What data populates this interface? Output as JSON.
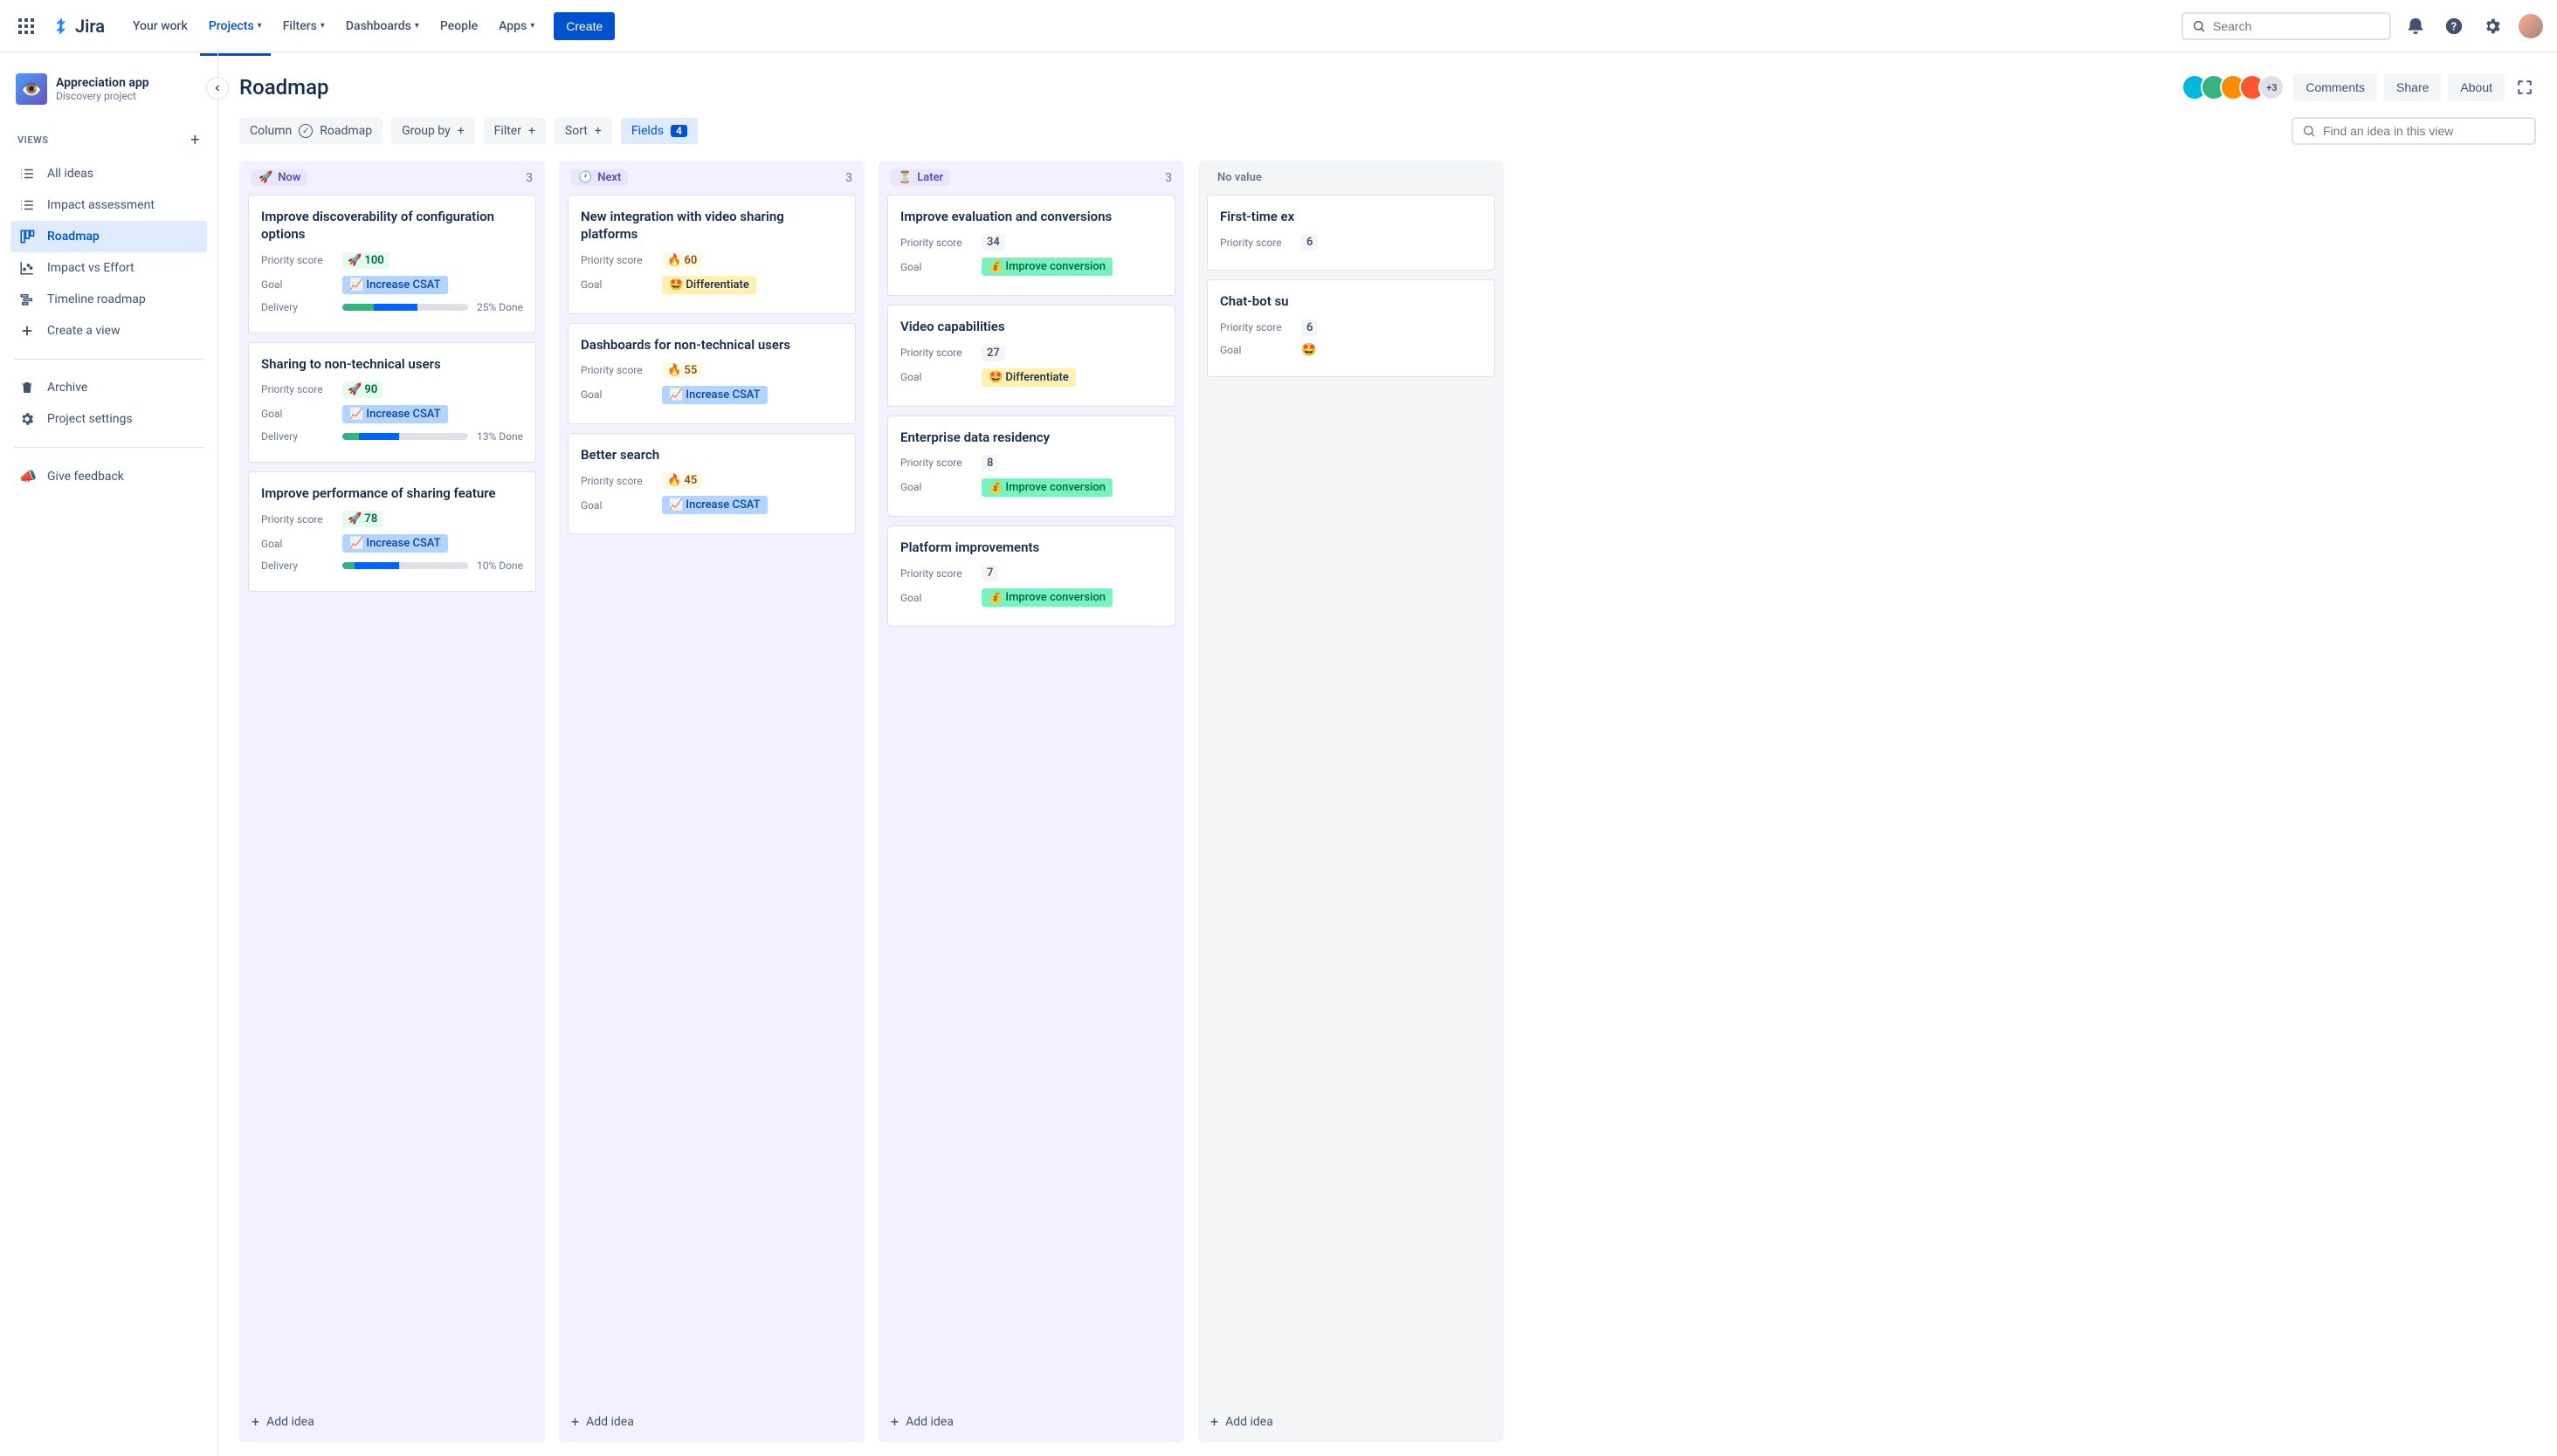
{
  "nav": {
    "logo": "Jira",
    "items": [
      "Your work",
      "Projects",
      "Filters",
      "Dashboards",
      "People",
      "Apps"
    ],
    "active_index": 1,
    "dropdowns": [
      false,
      true,
      true,
      true,
      false,
      true
    ],
    "create": "Create",
    "search_placeholder": "Search"
  },
  "project": {
    "name": "Appreciation app",
    "type": "Discovery project"
  },
  "sidebar": {
    "section": "VIEWS",
    "items": [
      {
        "icon": "list",
        "label": "All ideas"
      },
      {
        "icon": "list",
        "label": "Impact assessment"
      },
      {
        "icon": "board",
        "label": "Roadmap",
        "active": true
      },
      {
        "icon": "chart",
        "label": "Impact vs Effort"
      },
      {
        "icon": "timeline",
        "label": "Timeline roadmap"
      },
      {
        "icon": "plus",
        "label": "Create a view"
      }
    ],
    "footer": [
      {
        "icon": "trash",
        "label": "Archive"
      },
      {
        "icon": "gear",
        "label": "Project settings"
      }
    ],
    "feedback": "Give feedback"
  },
  "header": {
    "title": "Roadmap",
    "avatars_more": "+3",
    "buttons": [
      "Comments",
      "Share",
      "About"
    ]
  },
  "controls": {
    "column_label": "Column",
    "column_value": "Roadmap",
    "group_by": "Group by",
    "filter": "Filter",
    "sort": "Sort",
    "fields": "Fields",
    "fields_count": "4",
    "find_placeholder": "Find an idea in this view"
  },
  "board": {
    "add_idea": "Add idea",
    "field_labels": {
      "priority": "Priority score",
      "goal": "Goal",
      "delivery": "Delivery"
    },
    "columns": [
      {
        "key": "now",
        "emoji": "🚀",
        "name": "Now",
        "count": "3",
        "cards": [
          {
            "title": "Improve discoverability of configuration options",
            "score_emoji": "🚀",
            "score": "100",
            "score_class": "score-green",
            "goal_emoji": "📈",
            "goal": "Increase CSAT",
            "goal_class": "goal-blue",
            "delivery_done": 25,
            "delivery_in": 35,
            "delivery_label": "25% Done"
          },
          {
            "title": "Sharing to non-technical users",
            "score_emoji": "🚀",
            "score": "90",
            "score_class": "score-green",
            "goal_emoji": "📈",
            "goal": "Increase CSAT",
            "goal_class": "goal-blue",
            "delivery_done": 13,
            "delivery_in": 32,
            "delivery_label": "13% Done"
          },
          {
            "title": "Improve performance of sharing feature",
            "score_emoji": "🚀",
            "score": "78",
            "score_class": "score-green",
            "goal_emoji": "📈",
            "goal": "Increase CSAT",
            "goal_class": "goal-blue",
            "delivery_done": 10,
            "delivery_in": 35,
            "delivery_label": "10% Done"
          }
        ]
      },
      {
        "key": "next",
        "emoji": "🕐",
        "name": "Next",
        "count": "3",
        "cards": [
          {
            "title": "New integration with video sharing platforms",
            "score_emoji": "🔥",
            "score": "60",
            "score_class": "score-yellow",
            "goal_emoji": "🤩",
            "goal": "Differentiate",
            "goal_class": "goal-yellow"
          },
          {
            "title": "Dashboards for non-technical users",
            "score_emoji": "🔥",
            "score": "55",
            "score_class": "score-yellow",
            "goal_emoji": "📈",
            "goal": "Increase CSAT",
            "goal_class": "goal-blue"
          },
          {
            "title": "Better search",
            "score_emoji": "🔥",
            "score": "45",
            "score_class": "score-yellow",
            "goal_emoji": "📈",
            "goal": "Increase CSAT",
            "goal_class": "goal-blue"
          }
        ]
      },
      {
        "key": "later",
        "emoji": "⏳",
        "name": "Later",
        "count": "3",
        "cards": [
          {
            "title": "Improve evaluation and conversions",
            "score": "34",
            "score_class": "score-plain",
            "goal_emoji": "💰",
            "goal": "Improve conversion",
            "goal_class": "goal-teal"
          },
          {
            "title": "Video capabilities",
            "score": "27",
            "score_class": "score-plain",
            "goal_emoji": "🤩",
            "goal": "Differentiate",
            "goal_class": "goal-yellow"
          },
          {
            "title": "Enterprise data residency",
            "score": "8",
            "score_class": "score-plain",
            "goal_emoji": "💰",
            "goal": "Improve conversion",
            "goal_class": "goal-teal"
          },
          {
            "title": "Platform improvements",
            "score": "7",
            "score_class": "score-plain",
            "goal_emoji": "💰",
            "goal": "Improve conversion",
            "goal_class": "goal-teal"
          }
        ]
      },
      {
        "key": "novalue",
        "name": "No value",
        "cards": [
          {
            "title": "First-time ex",
            "score": "6",
            "score_class": "score-plain"
          },
          {
            "title": "Chat-bot su",
            "score": "6",
            "score_class": "score-plain",
            "goal_emoji": "🤩"
          }
        ]
      }
    ]
  }
}
